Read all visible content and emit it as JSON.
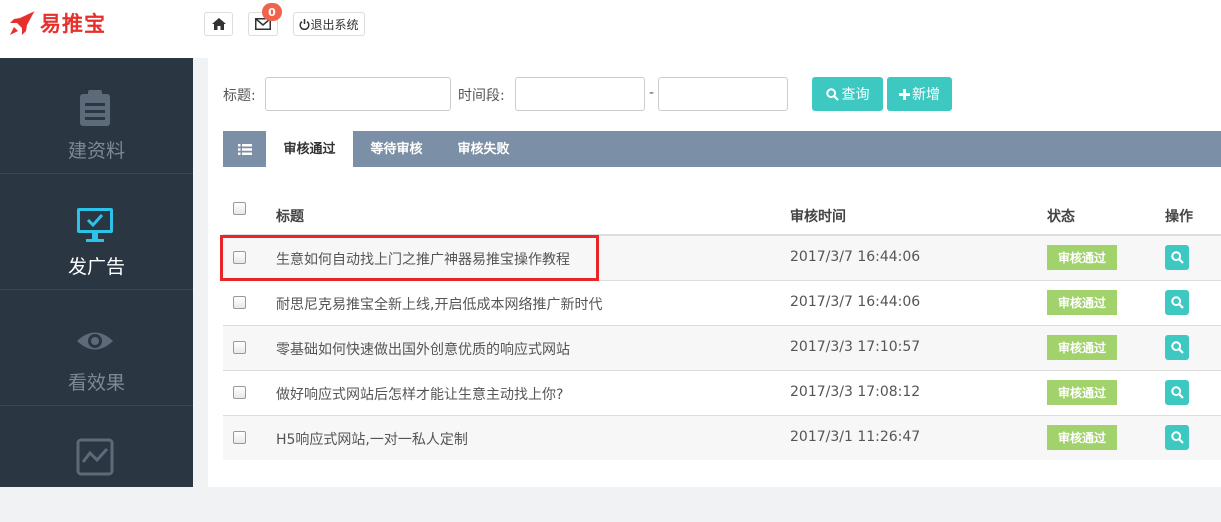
{
  "app": {
    "logo_text": "易推宝",
    "brand_color": "#e7302c",
    "accent_color": "#3ec8c2"
  },
  "topbar": {
    "home_icon": "home-icon",
    "mail_icon": "envelope-icon",
    "mail_badge": "0",
    "logout_label": "退出系统",
    "logout_icon": "power-icon"
  },
  "sidebar": {
    "items": [
      {
        "label": "建资料",
        "icon": "clipboard-icon",
        "active": false
      },
      {
        "label": "发广告",
        "icon": "monitor-check-icon",
        "active": true
      },
      {
        "label": "看效果",
        "icon": "eye-icon",
        "active": false
      },
      {
        "label": "",
        "icon": "chart-line-icon",
        "active": false
      }
    ]
  },
  "filters": {
    "title_label": "标题:",
    "title_value": "",
    "period_label": "时间段:",
    "date_from": "",
    "date_separator": "-",
    "date_to": "",
    "search_label": "查询",
    "add_label": "新增"
  },
  "tabs": [
    {
      "label": "审核通过",
      "active": true
    },
    {
      "label": "等待审核",
      "active": false
    },
    {
      "label": "审核失败",
      "active": false
    }
  ],
  "table": {
    "columns": [
      "标题",
      "审核时间",
      "状态",
      "操作"
    ],
    "rows": [
      {
        "title": "生意如何自动找上门之推广神器易推宝操作教程",
        "time": "2017/3/7 16:44:06",
        "status": "审核通过"
      },
      {
        "title": "耐思尼克易推宝全新上线,开启低成本网络推广新时代",
        "time": "2017/3/7 16:44:06",
        "status": "审核通过"
      },
      {
        "title": "零基础如何快速做出国外创意优质的响应式网站",
        "time": "2017/3/3 17:10:57",
        "status": "审核通过"
      },
      {
        "title": "做好响应式网站后怎样才能让生意主动找上你?",
        "time": "2017/3/3 17:08:12",
        "status": "审核通过"
      },
      {
        "title": "H5响应式网站,一对一私人定制",
        "time": "2017/3/1 11:26:47",
        "status": "审核通过"
      }
    ]
  }
}
